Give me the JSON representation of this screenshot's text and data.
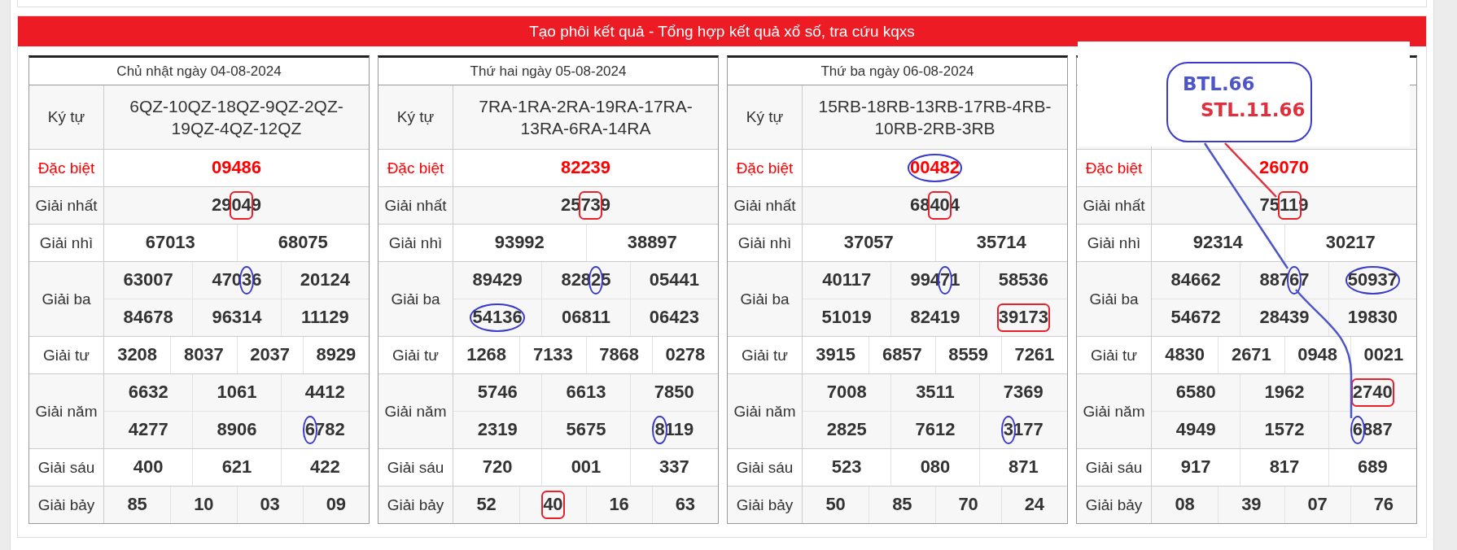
{
  "page_header": {
    "title": "Tạo phôi kết quả - Tổng hợp kết quả xổ số, tra cứu kqxs"
  },
  "days": [
    {
      "date": "Chủ nhật ngày 04-08-2024",
      "symbols_label": "Ký tự",
      "symbols": "6QZ-10QZ-18QZ-9QZ-2QZ-19QZ-4QZ-12QZ",
      "prizes": [
        {
          "label": "Đặc biệt",
          "kind": "special",
          "lines": [
            [
              {
                "value": "09486"
              }
            ]
          ]
        },
        {
          "label": "Giải nhất",
          "kind": "regular",
          "lines": [
            [
              {
                "value": "29049",
                "mark": {
                  "kind": "box",
                  "color": "#e8202a",
                  "digits": [
                    false,
                    false,
                    true,
                    true,
                    false
                  ]
                }
              }
            ]
          ]
        },
        {
          "label": "Giải nhì",
          "kind": "regular",
          "lines": [
            [
              {
                "value": "67013"
              },
              {
                "value": "68075"
              }
            ]
          ]
        },
        {
          "label": "Giải ba",
          "kind": "regular",
          "lines": [
            [
              {
                "value": "63007"
              },
              {
                "value": "47036",
                "mark": {
                  "kind": "ring",
                  "color": "#3a3acb",
                  "digits": [
                    false,
                    false,
                    false,
                    true,
                    false
                  ]
                }
              },
              {
                "value": "20124"
              }
            ],
            [
              {
                "value": "84678"
              },
              {
                "value": "96314"
              },
              {
                "value": "11129"
              }
            ]
          ]
        },
        {
          "label": "Giải tư",
          "kind": "regular",
          "lines": [
            [
              {
                "value": "3208"
              },
              {
                "value": "8037"
              },
              {
                "value": "2037"
              },
              {
                "value": "8929"
              }
            ]
          ]
        },
        {
          "label": "Giải năm",
          "kind": "regular",
          "lines": [
            [
              {
                "value": "6632"
              },
              {
                "value": "1061"
              },
              {
                "value": "4412"
              }
            ],
            [
              {
                "value": "4277"
              },
              {
                "value": "8906"
              },
              {
                "value": "6782",
                "mark": {
                  "kind": "ring",
                  "color": "#3a3acb",
                  "digits": [
                    true,
                    false,
                    false,
                    false
                  ]
                }
              }
            ]
          ]
        },
        {
          "label": "Giải sáu",
          "kind": "regular",
          "lines": [
            [
              {
                "value": "400"
              },
              {
                "value": "621"
              },
              {
                "value": "422"
              }
            ]
          ]
        },
        {
          "label": "Giải bảy",
          "kind": "regular",
          "lines": [
            [
              {
                "value": "85"
              },
              {
                "value": "10"
              },
              {
                "value": "03"
              },
              {
                "value": "09"
              }
            ]
          ]
        }
      ]
    },
    {
      "date": "Thứ hai ngày 05-08-2024",
      "symbols_label": "Ký tự",
      "symbols": "7RA-1RA-2RA-19RA-17RA-13RA-6RA-14RA",
      "prizes": [
        {
          "label": "Đặc biệt",
          "kind": "special",
          "lines": [
            [
              {
                "value": "82239"
              }
            ]
          ]
        },
        {
          "label": "Giải nhất",
          "kind": "regular",
          "lines": [
            [
              {
                "value": "25739",
                "mark": {
                  "kind": "box",
                  "color": "#e8202a",
                  "digits": [
                    false,
                    false,
                    true,
                    true,
                    false
                  ]
                }
              }
            ]
          ]
        },
        {
          "label": "Giải nhì",
          "kind": "regular",
          "lines": [
            [
              {
                "value": "93992"
              },
              {
                "value": "38897"
              }
            ]
          ]
        },
        {
          "label": "Giải ba",
          "kind": "regular",
          "lines": [
            [
              {
                "value": "89429"
              },
              {
                "value": "82825",
                "mark": {
                  "kind": "ring",
                  "color": "#3a3acb",
                  "digits": [
                    false,
                    false,
                    false,
                    true,
                    false
                  ]
                }
              },
              {
                "value": "05441"
              }
            ],
            [
              {
                "value": "54136",
                "mark": {
                  "kind": "ring",
                  "color": "#3a3acb",
                  "digits": [
                    true,
                    true,
                    true,
                    true,
                    true
                  ]
                }
              },
              {
                "value": "06811"
              },
              {
                "value": "06423"
              }
            ]
          ]
        },
        {
          "label": "Giải tư",
          "kind": "regular",
          "lines": [
            [
              {
                "value": "1268"
              },
              {
                "value": "7133"
              },
              {
                "value": "7868"
              },
              {
                "value": "0278"
              }
            ]
          ]
        },
        {
          "label": "Giải năm",
          "kind": "regular",
          "lines": [
            [
              {
                "value": "5746"
              },
              {
                "value": "6613"
              },
              {
                "value": "7850"
              }
            ],
            [
              {
                "value": "2319"
              },
              {
                "value": "5675"
              },
              {
                "value": "8119",
                "mark": {
                  "kind": "ring",
                  "color": "#3a3acb",
                  "digits": [
                    true,
                    false,
                    false,
                    false
                  ]
                }
              }
            ]
          ]
        },
        {
          "label": "Giải sáu",
          "kind": "regular",
          "lines": [
            [
              {
                "value": "720"
              },
              {
                "value": "001"
              },
              {
                "value": "337"
              }
            ]
          ]
        },
        {
          "label": "Giải bảy",
          "kind": "regular",
          "lines": [
            [
              {
                "value": "52"
              },
              {
                "value": "40",
                "mark": {
                  "kind": "box",
                  "color": "#e8202a",
                  "digits": [
                    true,
                    true
                  ]
                }
              },
              {
                "value": "16"
              },
              {
                "value": "63"
              }
            ]
          ]
        }
      ]
    },
    {
      "date": "Thứ ba ngày 06-08-2024",
      "symbols_label": "Ký tự",
      "symbols": "15RB-18RB-13RB-17RB-4RB-10RB-2RB-3RB",
      "prizes": [
        {
          "label": "Đặc biệt",
          "kind": "special",
          "lines": [
            [
              {
                "value": "00482",
                "mark": {
                  "kind": "ring",
                  "color": "#3a3acb",
                  "digits": [
                    true,
                    true,
                    true,
                    true,
                    true
                  ]
                }
              }
            ]
          ]
        },
        {
          "label": "Giải nhất",
          "kind": "regular",
          "lines": [
            [
              {
                "value": "68404",
                "mark": {
                  "kind": "box",
                  "color": "#e8202a",
                  "digits": [
                    false,
                    false,
                    true,
                    true,
                    false
                  ]
                }
              }
            ]
          ]
        },
        {
          "label": "Giải nhì",
          "kind": "regular",
          "lines": [
            [
              {
                "value": "37057"
              },
              {
                "value": "35714"
              }
            ]
          ]
        },
        {
          "label": "Giải ba",
          "kind": "regular",
          "lines": [
            [
              {
                "value": "40117"
              },
              {
                "value": "99471",
                "mark": {
                  "kind": "ring",
                  "color": "#3a3acb",
                  "digits": [
                    false,
                    false,
                    false,
                    true,
                    false
                  ]
                }
              },
              {
                "value": "58536"
              }
            ],
            [
              {
                "value": "51019"
              },
              {
                "value": "82419"
              },
              {
                "value": "39173",
                "mark": {
                  "kind": "box",
                  "color": "#e8202a",
                  "digits": [
                    true,
                    true,
                    true,
                    true,
                    true
                  ]
                }
              }
            ]
          ]
        },
        {
          "label": "Giải tư",
          "kind": "regular",
          "lines": [
            [
              {
                "value": "3915"
              },
              {
                "value": "6857"
              },
              {
                "value": "8559"
              },
              {
                "value": "7261"
              }
            ]
          ]
        },
        {
          "label": "Giải năm",
          "kind": "regular",
          "lines": [
            [
              {
                "value": "7008"
              },
              {
                "value": "3511"
              },
              {
                "value": "7369"
              }
            ],
            [
              {
                "value": "2825"
              },
              {
                "value": "7612"
              },
              {
                "value": "3177",
                "mark": {
                  "kind": "ring",
                  "color": "#3a3acb",
                  "digits": [
                    true,
                    false,
                    false,
                    false
                  ]
                }
              }
            ]
          ]
        },
        {
          "label": "Giải sáu",
          "kind": "regular",
          "lines": [
            [
              {
                "value": "523"
              },
              {
                "value": "080"
              },
              {
                "value": "871"
              }
            ]
          ]
        },
        {
          "label": "Giải bảy",
          "kind": "regular",
          "lines": [
            [
              {
                "value": "50"
              },
              {
                "value": "85"
              },
              {
                "value": "70"
              },
              {
                "value": "24"
              }
            ]
          ]
        }
      ]
    },
    {
      "prizes": [
        {
          "label": "Đặc biệt",
          "kind": "special",
          "lines": [
            [
              {
                "value": "26070"
              }
            ]
          ]
        },
        {
          "label": "Giải nhất",
          "kind": "regular",
          "lines": [
            [
              {
                "value": "75119",
                "mark": {
                  "kind": "box",
                  "color": "#e8202a",
                  "digits": [
                    false,
                    false,
                    true,
                    true,
                    false
                  ]
                }
              }
            ]
          ]
        },
        {
          "label": "Giải nhì",
          "kind": "regular",
          "lines": [
            [
              {
                "value": "92314"
              },
              {
                "value": "30217"
              }
            ]
          ]
        },
        {
          "label": "Giải ba",
          "kind": "regular",
          "lines": [
            [
              {
                "value": "84662"
              },
              {
                "value": "88767",
                "mark": {
                  "kind": "ring",
                  "color": "#3a3acb",
                  "digits": [
                    false,
                    false,
                    false,
                    true,
                    false
                  ]
                }
              },
              {
                "value": "50937",
                "mark": {
                  "kind": "ring",
                  "color": "#3a3acb",
                  "digits": [
                    true,
                    true,
                    true,
                    true,
                    true
                  ]
                }
              }
            ],
            [
              {
                "value": "54672"
              },
              {
                "value": "28439"
              },
              {
                "value": "19830"
              }
            ]
          ]
        },
        {
          "label": "Giải tư",
          "kind": "regular",
          "lines": [
            [
              {
                "value": "4830"
              },
              {
                "value": "2671"
              },
              {
                "value": "0948"
              },
              {
                "value": "0021"
              }
            ]
          ]
        },
        {
          "label": "Giải năm",
          "kind": "regular",
          "lines": [
            [
              {
                "value": "6580"
              },
              {
                "value": "1962"
              },
              {
                "value": "2740",
                "mark": {
                  "kind": "box",
                  "color": "#e8202a",
                  "digits": [
                    true,
                    true,
                    true,
                    true
                  ]
                }
              }
            ],
            [
              {
                "value": "4949"
              },
              {
                "value": "1572"
              },
              {
                "value": "6887",
                "mark": {
                  "kind": "ring",
                  "color": "#3a3acb",
                  "digits": [
                    true,
                    false,
                    false,
                    false
                  ]
                }
              }
            ]
          ]
        },
        {
          "label": "Giải sáu",
          "kind": "regular",
          "lines": [
            [
              {
                "value": "917"
              },
              {
                "value": "817"
              },
              {
                "value": "689"
              }
            ]
          ]
        },
        {
          "label": "Giải bảy",
          "kind": "regular",
          "lines": [
            [
              {
                "value": "08"
              },
              {
                "value": "39"
              },
              {
                "value": "07"
              },
              {
                "value": "76"
              }
            ]
          ]
        }
      ]
    }
  ],
  "callout": {
    "lines": [
      {
        "text": "BTL.66",
        "color": "#4d55c8"
      },
      {
        "text": "STL.11.66",
        "color": "#e0303c"
      }
    ]
  }
}
